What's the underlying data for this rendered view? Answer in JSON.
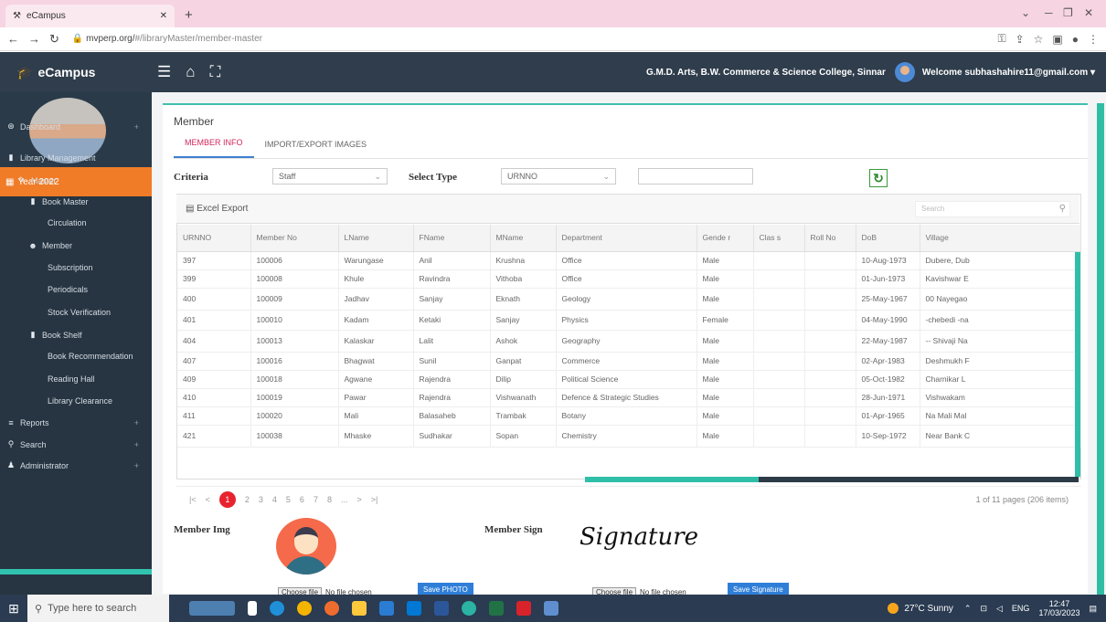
{
  "browser": {
    "tab_title": "eCampus",
    "url_domain": "mvperp.org/",
    "url_path": "#/libraryMaster/member-master"
  },
  "topnav": {
    "brand": "eCampus",
    "college": "G.M.D. Arts, B.W. Commerce & Science College, Sinnar",
    "welcome": "Welcome subhashahire11@gmail.com"
  },
  "sidebar": {
    "year": "Year 2022",
    "items": [
      {
        "label": "Dashboard",
        "icon": "dashboard-icon",
        "level": 0,
        "plus": true
      },
      {
        "label": "Library Management",
        "icon": "book-icon",
        "level": 0,
        "plus": false
      },
      {
        "label": "Master",
        "icon": "pencil-icon",
        "level": 1,
        "plus": false
      },
      {
        "label": "Book Master",
        "icon": "book-icon",
        "level": 2,
        "plus": false
      },
      {
        "label": "Circulation",
        "icon": "",
        "level": 3,
        "plus": false
      },
      {
        "label": "Member",
        "icon": "users-icon",
        "level": 2,
        "plus": false
      },
      {
        "label": "Subscription",
        "icon": "",
        "level": 3,
        "plus": false
      },
      {
        "label": "Periodicals",
        "icon": "",
        "level": 3,
        "plus": false
      },
      {
        "label": "Stock Verification",
        "icon": "",
        "level": 3,
        "plus": false
      },
      {
        "label": "Book Shelf",
        "icon": "book-icon",
        "level": 2,
        "plus": false
      },
      {
        "label": "Book Recommendation",
        "icon": "",
        "level": 3,
        "plus": false
      },
      {
        "label": "Reading Hall",
        "icon": "",
        "level": 3,
        "plus": false
      },
      {
        "label": "Library Clearance",
        "icon": "",
        "level": 3,
        "plus": false
      },
      {
        "label": "Reports",
        "icon": "list-icon",
        "level": 0,
        "plus": true
      },
      {
        "label": "Search",
        "icon": "search-icon",
        "level": 0,
        "plus": true
      },
      {
        "label": "Administrator",
        "icon": "user-icon",
        "level": 0,
        "plus": true
      }
    ]
  },
  "page": {
    "title": "Member",
    "tabs": [
      "MEMBER INFO",
      "IMPORT/EXPORT IMAGES"
    ],
    "criteria_label": "Criteria",
    "criteria_value": "Staff",
    "select_type_label": "Select Type",
    "select_type_value": "URNNO",
    "excel_export": "Excel Export",
    "search_placeholder": "Search"
  },
  "table": {
    "headers": [
      "URNNO",
      "Member No",
      "LName",
      "FName",
      "MName",
      "Department",
      "Gender",
      "Class",
      "Roll No",
      "DoB",
      "Village"
    ],
    "header_display": [
      "URNNO",
      "Member No",
      "LName",
      "FName",
      "MName",
      "Department",
      "Gende r",
      "Clas s",
      "Roll No",
      "DoB",
      "Village"
    ],
    "rows": [
      [
        "397",
        "100006",
        "Warungase",
        "Anil",
        "Krushna",
        "Office",
        "Male",
        "",
        "",
        "10-Aug-1973",
        "Dubere, Dub"
      ],
      [
        "399",
        "100008",
        "Khule",
        "Ravindra",
        "Vithoba",
        "Office",
        "Male",
        "",
        "",
        "01-Jun-1973",
        "Kavishwar E"
      ],
      [
        "400",
        "100009",
        "Jadhav",
        "Sanjay",
        "Eknath",
        "Geology",
        "Male",
        "",
        "",
        "25-May-1967",
        "00 Nayegao"
      ],
      [
        "401",
        "100010",
        "Kadam",
        "Ketaki",
        "Sanjay",
        "Physics",
        "Female",
        "",
        "",
        "04-May-1990",
        "-chebedi -na"
      ],
      [
        "404",
        "100013",
        "Kalaskar",
        "Lalit",
        "Ashok",
        "Geography",
        "Male",
        "",
        "",
        "22-May-1987",
        "-- Shivaji Na"
      ],
      [
        "407",
        "100016",
        "Bhagwat",
        "Sunil",
        "Ganpat",
        "Commerce",
        "Male",
        "",
        "",
        "02-Apr-1983",
        "Deshmukh F"
      ],
      [
        "409",
        "100018",
        "Agwane",
        "Rajendra",
        "Dilip",
        "Political Science",
        "Male",
        "",
        "",
        "05-Oct-1982",
        "Charnikar L"
      ],
      [
        "410",
        "100019",
        "Pawar",
        "Rajendra",
        "Vishwanath",
        "Defence & Strategic Studies",
        "Male",
        "",
        "",
        "28-Jun-1971",
        "Vishwakam"
      ],
      [
        "411",
        "100020",
        "Mali",
        "Balasaheb",
        "Trambak",
        "Botany",
        "Male",
        "",
        "",
        "01-Apr-1965",
        "Na Mali Mal"
      ],
      [
        "421",
        "100038",
        "Mhaske",
        "Sudhakar",
        "Sopan",
        "Chemistry",
        "Male",
        "",
        "",
        "10-Sep-1972",
        "Near Bank C"
      ]
    ]
  },
  "pager": {
    "pages": [
      "1",
      "2",
      "3",
      "4",
      "5",
      "6",
      "7",
      "8",
      "...",
      ">",
      ">|"
    ],
    "first": "|<",
    "prev": "<",
    "info": "1 of 11 pages (206 items)"
  },
  "images": {
    "member_img_label": "Member Img",
    "member_sign_label": "Member Sign",
    "signature_text": "Signature",
    "choose_file": "Choose file",
    "no_file": "No file chosen",
    "save_photo": "Save PHOTO",
    "save_signature": "Save Signature"
  },
  "taskbar": {
    "search_placeholder": "Type here to search",
    "weather": "27°C Sunny",
    "lang": "ENG",
    "time": "12:47",
    "date": "17/03/2023"
  },
  "colors": {
    "topnav": "#2f3d4c",
    "sidebar": "#273542",
    "year_bar": "#f07c28",
    "accent_teal": "#30bda6",
    "active_tab": "#d0285c",
    "pager_current": "#e8232f"
  }
}
